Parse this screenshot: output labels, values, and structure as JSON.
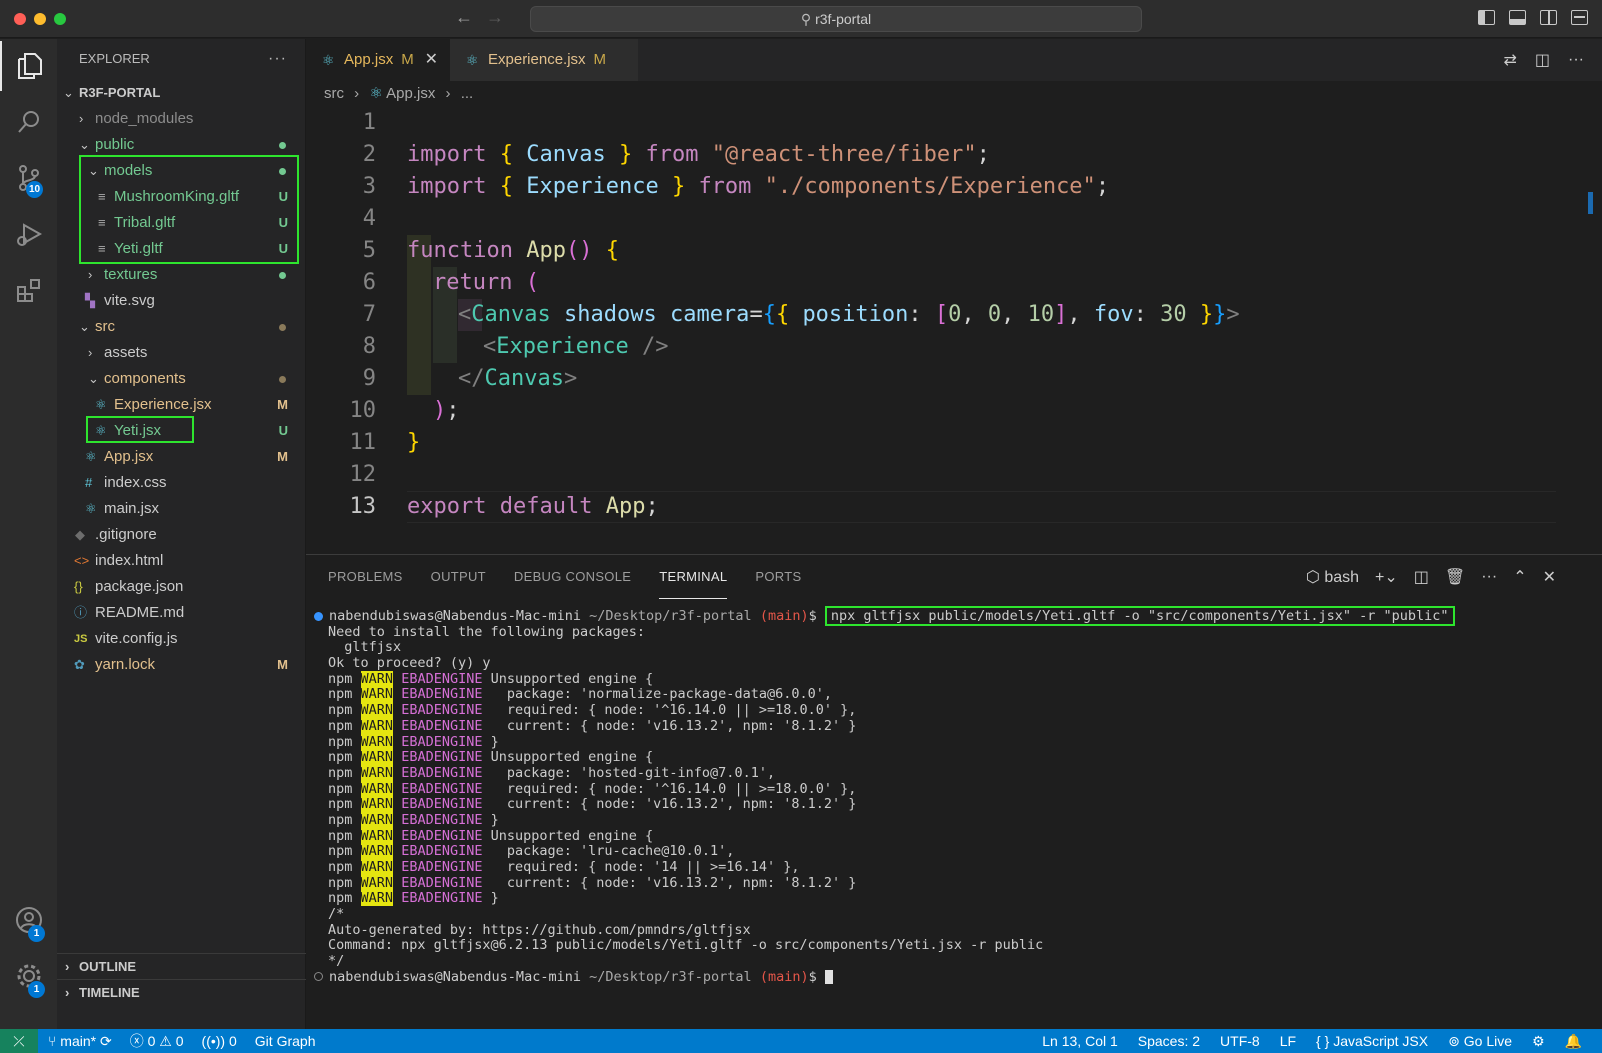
{
  "window": {
    "search_text": "r3f-portal"
  },
  "activity_bar": {
    "scm_badge": "10",
    "accounts_badge": "1",
    "settings_badge": "1"
  },
  "sidebar": {
    "header": "EXPLORER",
    "root": "R3F-PORTAL",
    "items": [
      {
        "label": "node_modules",
        "status": ""
      },
      {
        "label": "public",
        "status": ""
      },
      {
        "label": "models",
        "status": ""
      },
      {
        "label": "MushroomKing.gltf",
        "status": "U"
      },
      {
        "label": "Tribal.gltf",
        "status": "U"
      },
      {
        "label": "Yeti.gltf",
        "status": "U"
      },
      {
        "label": "textures",
        "status": ""
      },
      {
        "label": "vite.svg",
        "status": ""
      },
      {
        "label": "src",
        "status": ""
      },
      {
        "label": "assets",
        "status": ""
      },
      {
        "label": "components",
        "status": ""
      },
      {
        "label": "Experience.jsx",
        "status": "M"
      },
      {
        "label": "Yeti.jsx",
        "status": "U"
      },
      {
        "label": "App.jsx",
        "status": "M"
      },
      {
        "label": "index.css",
        "status": ""
      },
      {
        "label": "main.jsx",
        "status": ""
      },
      {
        "label": ".gitignore",
        "status": ""
      },
      {
        "label": "index.html",
        "status": ""
      },
      {
        "label": "package.json",
        "status": ""
      },
      {
        "label": "README.md",
        "status": ""
      },
      {
        "label": "vite.config.js",
        "status": ""
      },
      {
        "label": "yarn.lock",
        "status": "M"
      }
    ],
    "outline": "OUTLINE",
    "timeline": "TIMELINE"
  },
  "tabs": [
    {
      "label": "App.jsx",
      "mod": "M"
    },
    {
      "label": "Experience.jsx",
      "mod": "M"
    }
  ],
  "breadcrumb": {
    "folder": "src",
    "file": "App.jsx",
    "more": "..."
  },
  "line_numbers": [
    "1",
    "2",
    "3",
    "4",
    "5",
    "6",
    "7",
    "8",
    "9",
    "10",
    "11",
    "12",
    "13"
  ],
  "code": {
    "l1": [
      "import",
      "{",
      "Canvas",
      "}",
      "from",
      "\"@react-three/fiber\"",
      ";"
    ],
    "l2": [
      "import",
      "{",
      "Experience",
      "}",
      "from",
      "\"./components/Experience\"",
      ";"
    ],
    "l4": [
      "function",
      "App",
      "()",
      "{"
    ],
    "l5": [
      "return",
      "("
    ],
    "l6": [
      "<",
      "Canvas",
      "shadows",
      "camera",
      "=",
      "{",
      "{",
      "position",
      ":",
      "[",
      "0",
      ",",
      "0",
      ",",
      "10",
      "]",
      ",",
      "fov",
      ":",
      "30",
      "}",
      "}",
      ">"
    ],
    "l7": [
      "<",
      "Experience",
      "/>"
    ],
    "l8": [
      "</",
      "Canvas",
      ">"
    ],
    "l9": [
      ")",
      ";"
    ],
    "l10": [
      "}"
    ],
    "l12": [
      "export",
      "default",
      "App",
      ";"
    ]
  },
  "panel": {
    "tabs": [
      "PROBLEMS",
      "OUTPUT",
      "DEBUG CONSOLE",
      "TERMINAL",
      "PORTS"
    ],
    "shell": "bash"
  },
  "terminal": {
    "user": "nabendubiswas@Nabendus-Mac-mini",
    "path": "~/Desktop/r3f-portal",
    "branch": "(main)",
    "command": "npx gltfjsx public/models/Yeti.gltf -o \"src/components/Yeti.jsx\" -r \"public\"",
    "lines": [
      "Need to install the following packages:",
      "  gltfjsx",
      "Ok to proceed? (y) y"
    ],
    "warn_blocks": [
      {
        "pkg": "  package: 'normalize-package-data@6.0.0',",
        "req": "  required: { node: '^16.14.0 || >=18.0.0' },",
        "cur": "  current: { node: 'v16.13.2', npm: '8.1.2' }"
      },
      {
        "pkg": "  package: 'hosted-git-info@7.0.1',",
        "req": "  required: { node: '^16.14.0 || >=18.0.0' },",
        "cur": "  current: { node: 'v16.13.2', npm: '8.1.2' }"
      },
      {
        "pkg": "  package: 'lru-cache@10.0.1',",
        "req": "  required: { node: '14 || >=16.14' },",
        "cur": "  current: { node: 'v16.13.2', npm: '8.1.2' }"
      }
    ],
    "npm": "npm",
    "warn": "WARN",
    "ebad": "EBADENGINE",
    "unsupported": "Unsupported engine {",
    "close_brace": "}",
    "tail": [
      "/*",
      "Auto-generated by: https://github.com/pmndrs/gltfjsx",
      "Command: npx gltfjsx@6.2.13 public/models/Yeti.gltf -o src/components/Yeti.jsx -r public",
      "*/"
    ]
  },
  "statusbar": {
    "branch": "main*",
    "errors": "0",
    "warnings": "0",
    "ports": "0",
    "git_graph": "Git Graph",
    "position": "Ln 13, Col 1",
    "spaces": "Spaces: 2",
    "encoding": "UTF-8",
    "eol": "LF",
    "language": "JavaScript JSX",
    "golive": "Go Live"
  }
}
